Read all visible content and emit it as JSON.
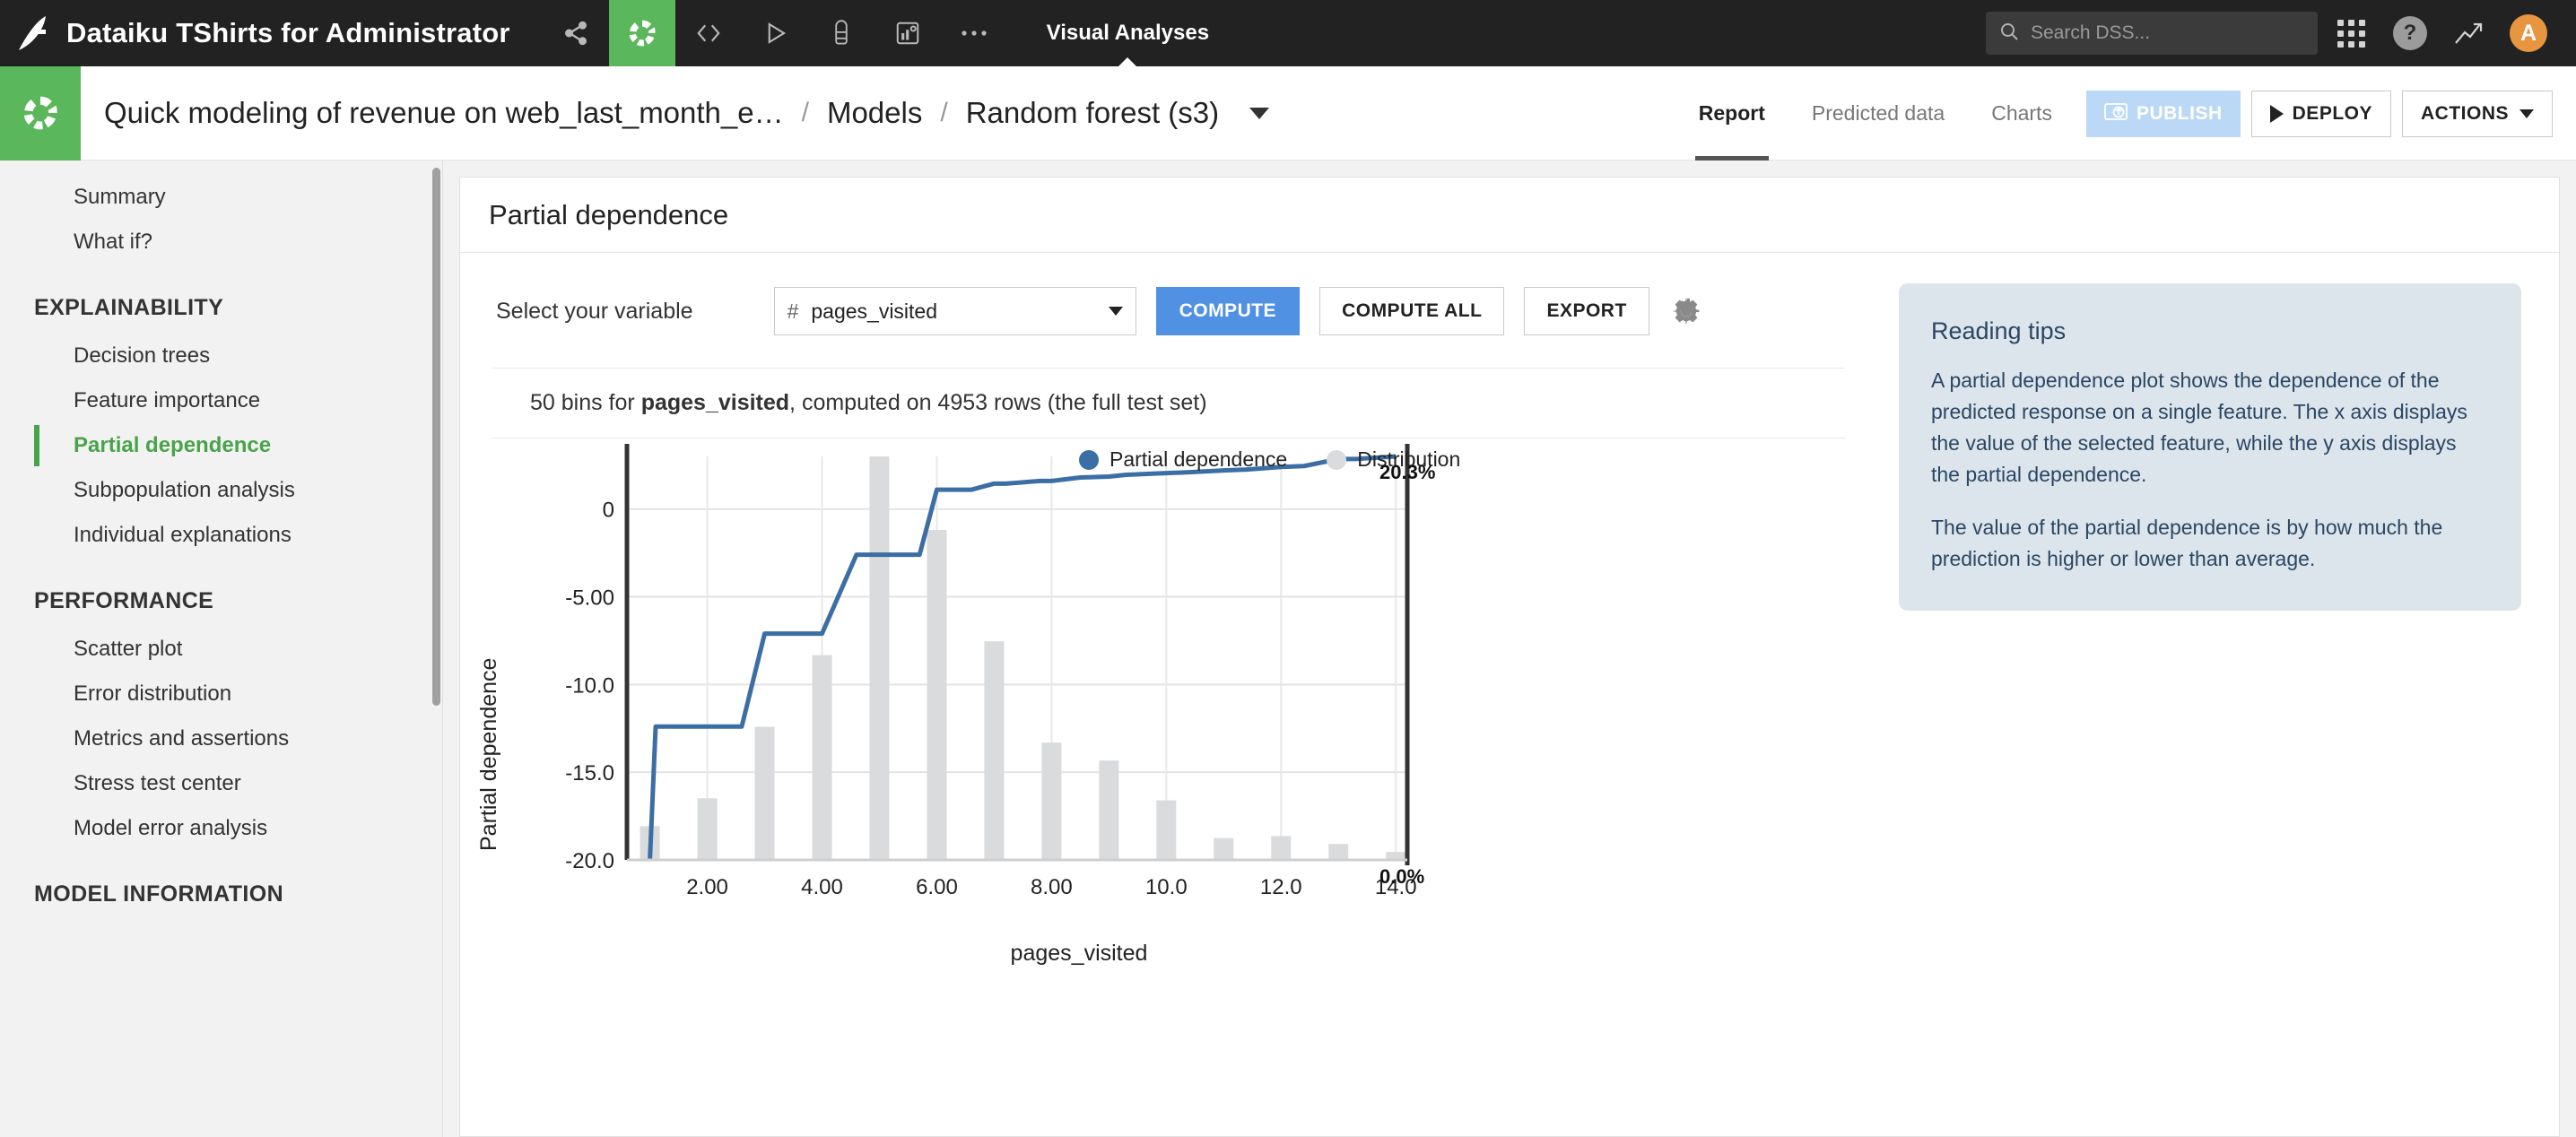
{
  "topbar": {
    "logo_icon": "dataiku-bird-logo",
    "project_title": "Dataiku TShirts for Administrator",
    "icons": [
      {
        "name": "flow-icon",
        "glyph": "share"
      },
      {
        "name": "lab-icon",
        "glyph": "donut"
      },
      {
        "name": "code-icon",
        "glyph": "code"
      },
      {
        "name": "run-icon",
        "glyph": "play"
      },
      {
        "name": "jobs-icon",
        "glyph": "stack"
      },
      {
        "name": "dashboard-icon",
        "glyph": "report"
      },
      {
        "name": "more-icon",
        "glyph": "ellipsis"
      }
    ],
    "section_label": "Visual Analyses",
    "search_placeholder": "Search DSS...",
    "search_value": "",
    "apps_icon": "grid-apps-icon",
    "help_icon": "help-icon",
    "help_glyph": "?",
    "trending_icon": "trending-up-icon",
    "avatar_initial": "A"
  },
  "breadcrumb": {
    "logo_icon": "analysis-donut-logo",
    "items": [
      {
        "label": "Quick modeling of revenue on web_last_month_e…"
      },
      {
        "label": "Models"
      },
      {
        "label": "Random forest (s3)"
      }
    ],
    "separator": "/",
    "dropdown_icon": "chevron-down-icon",
    "tabs": [
      {
        "label": "Report",
        "active": true
      },
      {
        "label": "Predicted data",
        "active": false
      },
      {
        "label": "Charts",
        "active": false
      }
    ],
    "publish_label": "PUBLISH",
    "publish_icon": "publish-icon",
    "deploy_label": "DEPLOY",
    "deploy_icon": "play-icon",
    "actions_label": "ACTIONS",
    "actions_icon": "chevron-down-icon"
  },
  "sidebar": {
    "items": [
      {
        "label": "Summary",
        "type": "item",
        "active": false
      },
      {
        "label": "What if?",
        "type": "item",
        "active": false
      },
      {
        "label": "EXPLAINABILITY",
        "type": "header"
      },
      {
        "label": "Decision trees",
        "type": "item",
        "active": false
      },
      {
        "label": "Feature importance",
        "type": "item",
        "active": false
      },
      {
        "label": "Partial dependence",
        "type": "item",
        "active": true
      },
      {
        "label": "Subpopulation analysis",
        "type": "item",
        "active": false
      },
      {
        "label": "Individual explanations",
        "type": "item",
        "active": false
      },
      {
        "label": "PERFORMANCE",
        "type": "header"
      },
      {
        "label": "Scatter plot",
        "type": "item",
        "active": false
      },
      {
        "label": "Error distribution",
        "type": "item",
        "active": false
      },
      {
        "label": "Metrics and assertions",
        "type": "item",
        "active": false
      },
      {
        "label": "Stress test center",
        "type": "item",
        "active": false
      },
      {
        "label": "Model error analysis",
        "type": "item",
        "active": false
      },
      {
        "label": "MODEL INFORMATION",
        "type": "header"
      }
    ]
  },
  "panel": {
    "title": "Partial dependence",
    "controls": {
      "select_label": "Select your variable",
      "variable_prefix": "#",
      "variable_value": "pages_visited",
      "dropdown_icon": "chevron-down-icon",
      "compute_label": "COMPUTE",
      "compute_all_label": "COMPUTE ALL",
      "export_label": "EXPORT",
      "settings_icon": "gear-icon"
    },
    "bins_text_pre": "50 bins for ",
    "bins_variable": "pages_visited",
    "bins_text_post": ", computed on 4953 rows (the full test set)"
  },
  "tips": {
    "title": "Reading tips",
    "paragraph1": "A partial dependence plot shows the dependence of the predicted response on a single feature. The x axis displays the value of the selected feature, while the y axis displays the partial dependence.",
    "paragraph2": "The value of the partial dependence is by how much the prediction is higher or lower than average."
  },
  "chart_data": {
    "type": "line",
    "title": "",
    "xlabel": "pages_visited",
    "ylabel": "Partial dependence",
    "xlim": [
      0.6,
      14.2
    ],
    "ylim": [
      -20.0,
      3.0
    ],
    "xticks": [
      "2.00",
      "4.00",
      "6.00",
      "8.00",
      "10.0",
      "12.0",
      "14.0"
    ],
    "xtick_values": [
      2,
      4,
      6,
      8,
      10,
      12,
      14
    ],
    "yticks": [
      "0",
      "-5.00",
      "-10.0",
      "-15.0",
      "-20.0"
    ],
    "ytick_values": [
      0,
      -5,
      -10,
      -15,
      -20
    ],
    "grid": true,
    "legend_position": "top-right",
    "legend": [
      {
        "label": "Partial dependence",
        "color": "#3b6ea5",
        "marker": "dot"
      },
      {
        "label": "Distribution",
        "color": "#d9dbdd",
        "marker": "dot"
      }
    ],
    "right_axis": {
      "top_label": "20.3%",
      "bottom_label": "0.0%",
      "max": 20.3,
      "min": 0.0
    },
    "series": [
      {
        "name": "Partial dependence",
        "color": "#3b6ea5",
        "x": [
          1.0,
          1.1,
          1.6,
          2.0,
          2.6,
          3.0,
          3.1,
          3.8,
          4.0,
          4.6,
          5.0,
          5.1,
          5.7,
          6.0,
          6.1,
          6.6,
          7.0,
          7.2,
          7.8,
          8.0,
          8.5,
          9.0,
          9.3,
          10.0,
          10.4,
          11.0,
          11.4,
          12.0,
          12.4,
          13.0,
          13.3,
          14.0
        ],
        "y": [
          -20.0,
          -12.4,
          -12.4,
          -12.4,
          -12.4,
          -7.1,
          -7.1,
          -7.1,
          -7.1,
          -2.6,
          -2.6,
          -2.6,
          -2.6,
          1.1,
          1.1,
          1.1,
          1.45,
          1.45,
          1.6,
          1.6,
          1.8,
          1.85,
          1.95,
          2.05,
          2.1,
          2.2,
          2.25,
          2.4,
          2.45,
          2.85,
          2.85,
          3.0
        ]
      }
    ],
    "distribution": {
      "name": "Distribution",
      "color": "#d9dbdd",
      "unit": "percent",
      "x": [
        1,
        2,
        3,
        4,
        5,
        6,
        7,
        8,
        9,
        10,
        11,
        12,
        13,
        14
      ],
      "values": [
        1.7,
        3.1,
        6.7,
        10.3,
        20.3,
        16.6,
        11.0,
        5.9,
        5.0,
        3.0,
        1.1,
        1.2,
        0.8,
        0.4
      ]
    }
  }
}
